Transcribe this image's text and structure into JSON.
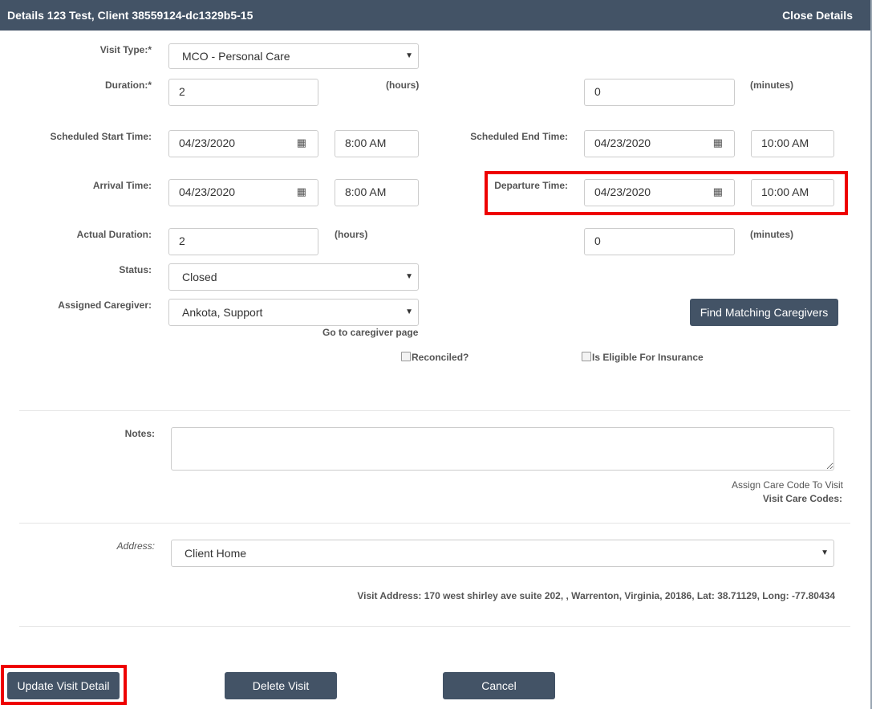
{
  "header": {
    "title": "Details 123 Test, Client 38559124-dc1329b5-15",
    "close_label": "Close Details"
  },
  "form": {
    "visit_type": {
      "label": "Visit Type:*",
      "value": "MCO - Personal Care"
    },
    "duration": {
      "label": "Duration:*",
      "hours_value": "2",
      "hours_unit": "(hours)",
      "minutes_value": "0",
      "minutes_unit": "(minutes)"
    },
    "scheduled_start": {
      "label": "Scheduled Start Time:",
      "date": "04/23/2020",
      "time": "8:00 AM"
    },
    "scheduled_end": {
      "label": "Scheduled End Time:",
      "date": "04/23/2020",
      "time": "10:00 AM"
    },
    "arrival": {
      "label": "Arrival Time:",
      "date": "04/23/2020",
      "time": "8:00 AM"
    },
    "departure": {
      "label": "Departure Time:",
      "date": "04/23/2020",
      "time": "10:00 AM"
    },
    "actual_duration": {
      "label": "Actual Duration:",
      "hours_value": "2",
      "hours_unit": "(hours)",
      "minutes_value": "0",
      "minutes_unit": "(minutes)"
    },
    "status": {
      "label": "Status:",
      "value": "Closed"
    },
    "caregiver": {
      "label": "Assigned Caregiver:",
      "value": "Ankota, Support",
      "link": "Go to caregiver page",
      "find_button": "Find Matching Caregivers"
    },
    "reconciled_label": "Reconciled?",
    "eligible_label": "Is Eligible For Insurance",
    "notes": {
      "label": "Notes:",
      "value": ""
    },
    "care_code": {
      "link": "Assign Care Code To Visit",
      "codes_label": "Visit Care Codes:"
    },
    "address": {
      "label": "Address:",
      "value": "Client Home",
      "visit_address": "Visit Address: 170 west shirley ave suite 202, , Warrenton, Virginia, 20186, Lat: 38.71129, Long: -77.80434"
    }
  },
  "actions": {
    "update": "Update Visit Detail",
    "delete": "Delete Visit",
    "cancel": "Cancel"
  },
  "icons": {
    "calendar": "calendar-icon",
    "caret": "chevron-down-icon"
  },
  "colors": {
    "header": "#435366",
    "button": "#435366",
    "highlight": "#ee0000"
  }
}
